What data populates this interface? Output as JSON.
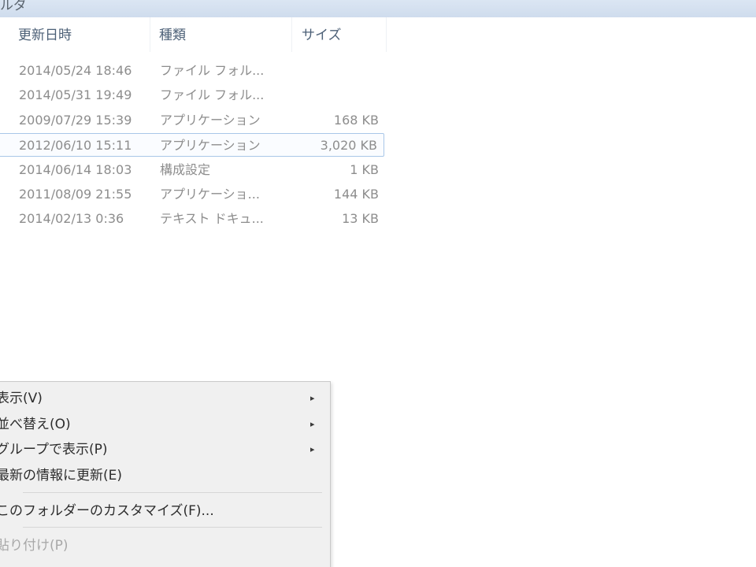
{
  "titlebar": {
    "text": "ルダ"
  },
  "columns": [
    {
      "label": "更新日時"
    },
    {
      "label": "種類"
    },
    {
      "label": "サイズ"
    }
  ],
  "files": [
    {
      "date": "2014/05/24 18:46",
      "type": "ファイル フォル...",
      "size": ""
    },
    {
      "date": "2014/05/31 19:49",
      "type": "ファイル フォル...",
      "size": ""
    },
    {
      "date": "2009/07/29 15:39",
      "type": "アプリケーション",
      "size": "168 KB"
    },
    {
      "date": "2012/06/10 15:11",
      "type": "アプリケーション",
      "size": "3,020 KB"
    },
    {
      "date": "2014/06/14 18:03",
      "type": "構成設定",
      "size": "1 KB"
    },
    {
      "date": "2011/08/09 21:55",
      "type": "アプリケーショ...",
      "size": "144 KB"
    },
    {
      "date": "2014/02/13 0:36",
      "type": "テキスト ドキュ...",
      "size": "13 KB"
    }
  ],
  "context_menu": {
    "items": [
      {
        "label": "表示(V)",
        "submenu": true,
        "arrow": "▸",
        "disabled": false
      },
      {
        "label": "並べ替え(O)",
        "submenu": true,
        "arrow": "▸",
        "disabled": false
      },
      {
        "label": "グループで表示(P)",
        "submenu": true,
        "arrow": "▸",
        "disabled": false
      },
      {
        "label": "最新の情報に更新(E)",
        "submenu": false,
        "arrow": "",
        "disabled": false
      },
      {
        "label": "このフォルダーのカスタマイズ(F)...",
        "submenu": false,
        "arrow": "",
        "disabled": false
      },
      {
        "label": "貼り付け(P)",
        "submenu": false,
        "arrow": "",
        "disabled": true
      }
    ]
  },
  "colors": {
    "selection_border": "#a9c7e8",
    "menu_background": "#f0f0f0",
    "header_text": "#4c6077",
    "row_text": "#8d8d8d"
  }
}
